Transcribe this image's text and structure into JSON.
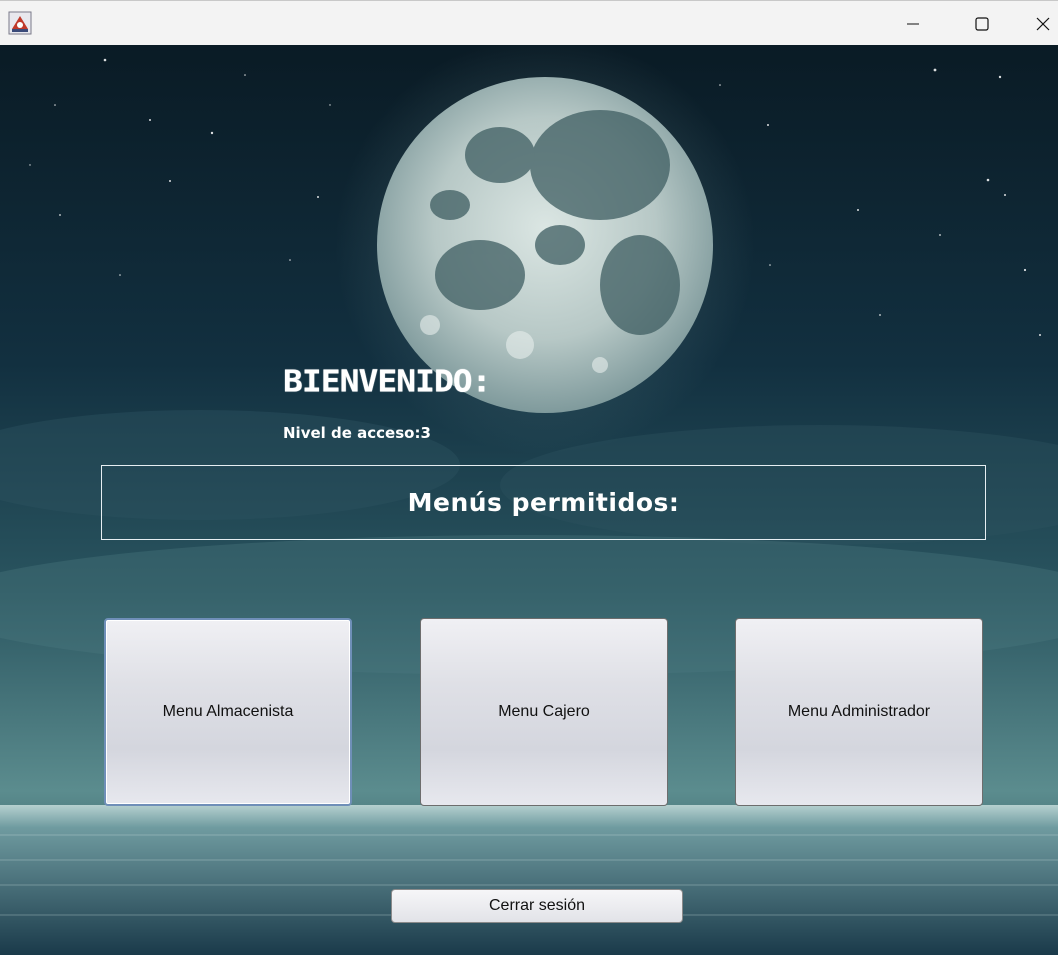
{
  "window": {
    "icon": "java-app-icon",
    "controls": [
      "minimize-icon",
      "maximize-icon",
      "close-icon"
    ]
  },
  "welcome": {
    "title": "BIENVENIDO:",
    "access_level": "Nivel de acceso:3"
  },
  "menus": {
    "heading": "Menús permitidos:",
    "buttons": [
      {
        "label": "Menu Almacenista"
      },
      {
        "label": "Menu Cajero"
      },
      {
        "label": "Menu Administrador"
      }
    ]
  },
  "logout": {
    "label": "Cerrar sesión"
  },
  "colors": {
    "background_sky": "#0c2230",
    "moon": "#c9d6d4",
    "text": "#ffffff"
  }
}
